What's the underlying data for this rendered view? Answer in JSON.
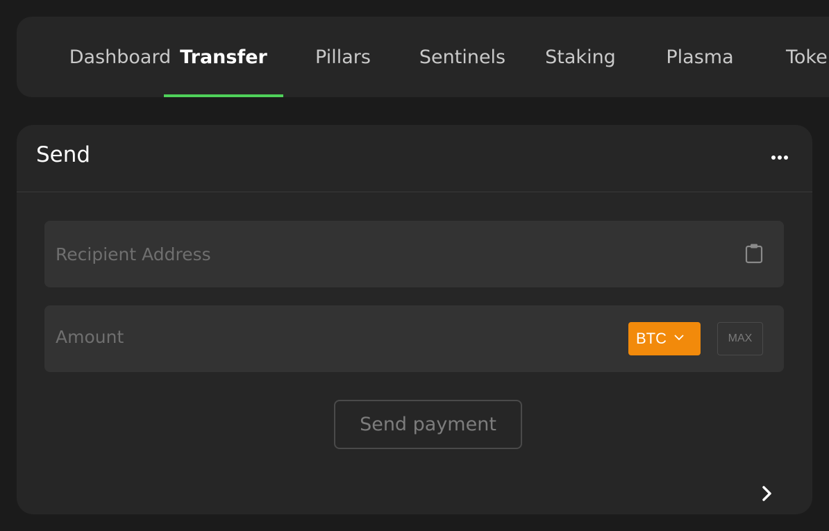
{
  "nav": {
    "tabs": [
      {
        "label": "Dashboard",
        "active": false
      },
      {
        "label": "Transfer",
        "active": true
      },
      {
        "label": "Pillars",
        "active": false
      },
      {
        "label": "Sentinels",
        "active": false
      },
      {
        "label": "Staking",
        "active": false
      },
      {
        "label": "Plasma",
        "active": false
      },
      {
        "label": "Tokens",
        "active": false
      }
    ],
    "active_underline_color": "#4fd15a"
  },
  "send_card": {
    "title": "Send",
    "more_icon": "more-horizontal-icon",
    "recipient": {
      "placeholder": "Recipient Address",
      "value": "",
      "paste_icon": "clipboard-icon"
    },
    "amount": {
      "placeholder": "Amount",
      "value": "",
      "token": "BTC",
      "token_color": "#f28a0b",
      "token_dropdown_icon": "chevron-down-icon",
      "max_label": "MAX"
    },
    "send_button_label": "Send payment",
    "expand_icon": "chevron-right-icon"
  }
}
